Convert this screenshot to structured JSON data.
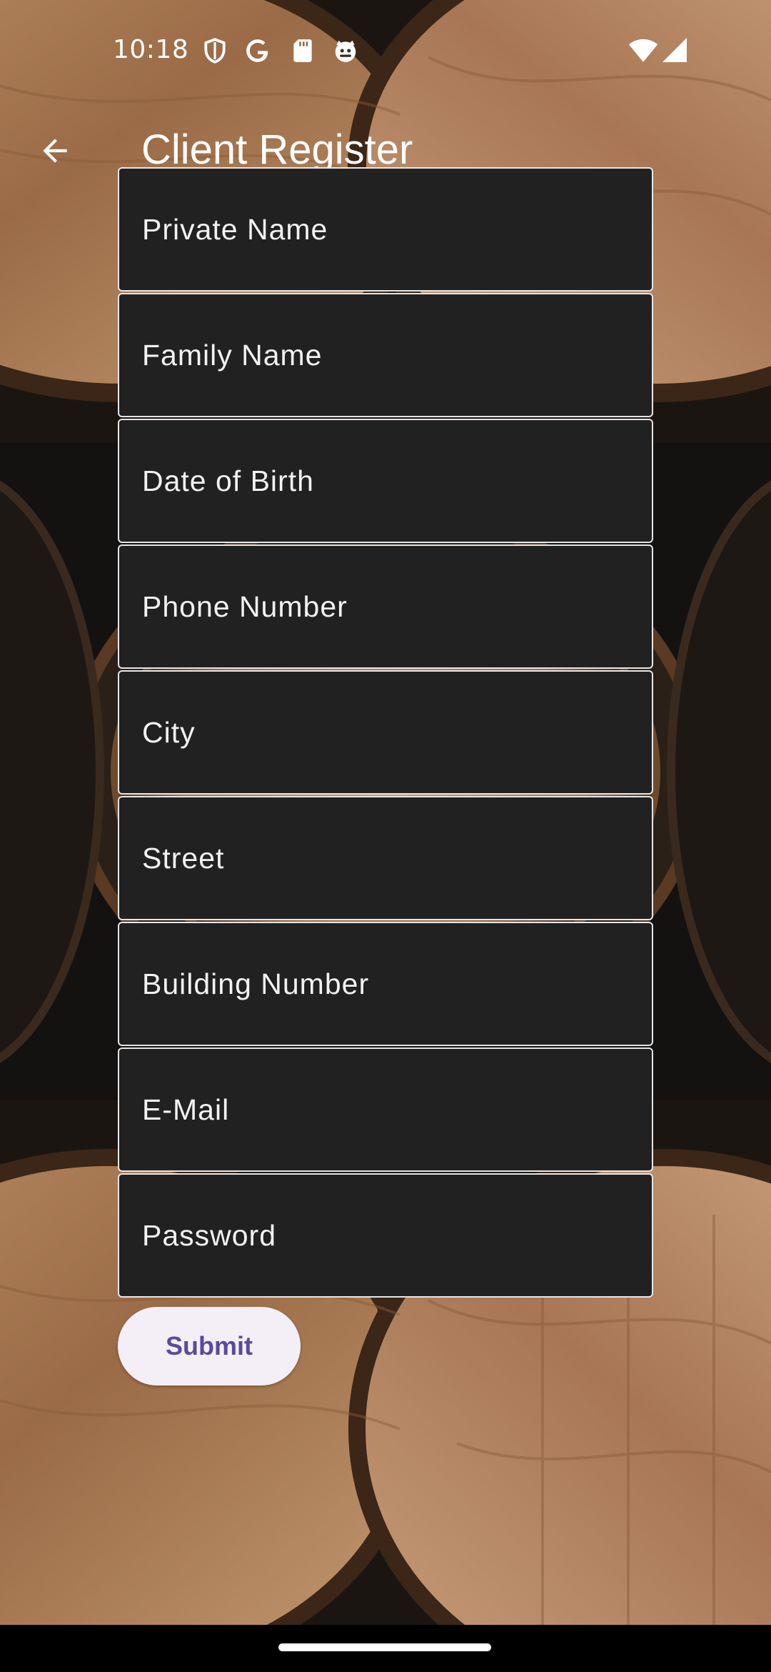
{
  "status_bar": {
    "time": "10:18",
    "icons": [
      "shield-icon",
      "google-icon",
      "sd-card-icon",
      "face-icon",
      "wifi-icon",
      "cell-signal-icon"
    ]
  },
  "app_bar": {
    "back_icon": "arrow-left-icon",
    "title": "Client Register"
  },
  "form": {
    "fields": [
      {
        "label": "Private Name"
      },
      {
        "label": "Family Name"
      },
      {
        "label": "Date of Birth"
      },
      {
        "label": "Phone Number"
      },
      {
        "label": "City"
      },
      {
        "label": "Street"
      },
      {
        "label": "Building Number"
      },
      {
        "label": "E-Mail"
      },
      {
        "label": "Password"
      }
    ],
    "submit_label": "Submit"
  },
  "colors": {
    "field_background": "#212121",
    "field_border": "#e6e6e6",
    "button_background": "#f4eef7",
    "button_text": "#5b4a98"
  },
  "background": "wooden-barrels"
}
